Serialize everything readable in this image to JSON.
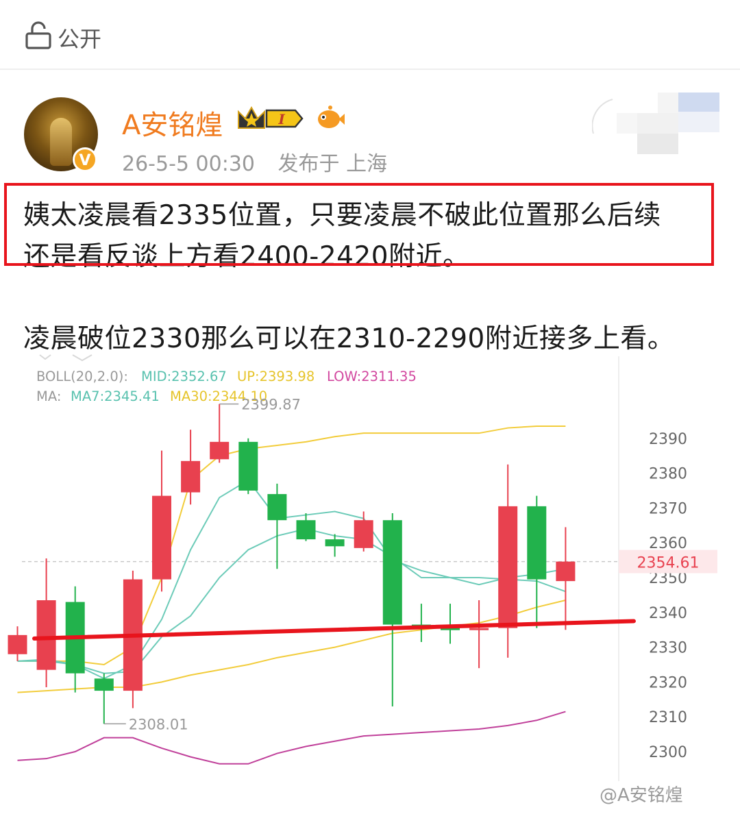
{
  "header": {
    "visibility_label": "公开",
    "lock_icon": "lock-icon"
  },
  "post": {
    "author": "A安铭煌",
    "badges": [
      "crown-badge-icon",
      "fish-badge-icon"
    ],
    "level_badge": "I",
    "verified_icon": "verified-v-icon",
    "timestamp": "26-5-5 00:30",
    "location": "发布于 上海",
    "paragraphs": [
      "姨太凌晨看2335位置，只要凌晨不破此位置那么后续",
      "还是看反谈上方看2400-2420附近。",
      "凌晨破位2330那么可以在2310-2290附近接多上看。"
    ]
  },
  "indicators": {
    "boll_label": "BOLL(20,2.0):",
    "mid": "MID:2352.67",
    "up": "UP:2393.98",
    "low": "LOW:2311.35",
    "ma_label": "MA:",
    "ma7": "MA7:2345.41",
    "ma30": "MA30:2344.10"
  },
  "watermark": "@A安铭煌",
  "colors": {
    "up": "#e8414f",
    "down": "#22b24c",
    "boll_up": "#f2cc3a",
    "boll_low": "#c0409a",
    "mid": "#6ccbb8",
    "highlight": "#e8141c",
    "username": "#f07b1f"
  },
  "chart_data": {
    "type": "candlestick",
    "yticks": [
      2300,
      2310,
      2320,
      2330,
      2340,
      2350,
      2360,
      2370,
      2380,
      2390
    ],
    "ylim": [
      2297.5,
      2399
    ],
    "current_price": 2354.61,
    "annotations": {
      "high": "2399.87",
      "low": "2308.01",
      "current": "2354.61"
    },
    "candles": [
      {
        "o": 2328.0,
        "c": 2333.5,
        "h": 2336.0,
        "l": 2326.0
      },
      {
        "o": 2323.5,
        "c": 2343.5,
        "h": 2355.5,
        "l": 2318.5
      },
      {
        "o": 2343.0,
        "c": 2322.5,
        "h": 2347.5,
        "l": 2317.0
      },
      {
        "o": 2321.0,
        "c": 2317.5,
        "h": 2322.5,
        "l": 2308.0
      },
      {
        "o": 2317.5,
        "c": 2349.5,
        "h": 2352.0,
        "l": 2312.5
      },
      {
        "o": 2349.5,
        "c": 2373.5,
        "h": 2386.5,
        "l": 2346.0
      },
      {
        "o": 2374.5,
        "c": 2383.5,
        "h": 2392.5,
        "l": 2371.0
      },
      {
        "o": 2384.0,
        "c": 2389.0,
        "h": 2399.87,
        "l": 2383.0
      },
      {
        "o": 2389.0,
        "c": 2375.0,
        "h": 2390.0,
        "l": 2374.0
      },
      {
        "o": 2374.0,
        "c": 2366.5,
        "h": 2377.0,
        "l": 2352.5
      },
      {
        "o": 2366.5,
        "c": 2361.0,
        "h": 2368.5,
        "l": 2360.5
      },
      {
        "o": 2361.0,
        "c": 2359.0,
        "h": 2362.5,
        "l": 2356.0
      },
      {
        "o": 2358.5,
        "c": 2366.5,
        "h": 2369.0,
        "l": 2357.5
      },
      {
        "o": 2366.5,
        "c": 2336.5,
        "h": 2368.5,
        "l": 2313.0
      },
      {
        "o": 2336.5,
        "c": 2336.0,
        "h": 2342.5,
        "l": 2331.5
      },
      {
        "o": 2335.5,
        "c": 2335.0,
        "h": 2342.5,
        "l": 2331.0
      },
      {
        "o": 2335.0,
        "c": 2335.5,
        "h": 2343.5,
        "l": 2324.0
      },
      {
        "o": 2335.5,
        "c": 2370.5,
        "h": 2382.5,
        "l": 2327.0
      },
      {
        "o": 2370.5,
        "c": 2349.5,
        "h": 2373.5,
        "l": 2335.5
      },
      {
        "o": 2349.0,
        "c": 2354.61,
        "h": 2364.5,
        "l": 2335.0
      }
    ],
    "boll_up": [
      2326,
      2326,
      2326,
      2325,
      2330,
      2350,
      2378,
      2385,
      2387,
      2388,
      2389,
      2390.5,
      2391.5,
      2391.5,
      2391.5,
      2391.5,
      2391.5,
      2393,
      2393.5,
      2393.5
    ],
    "boll_mid": [
      2326,
      2326,
      2325,
      2321,
      2325,
      2338,
      2358,
      2373,
      2378,
      2367,
      2368,
      2369,
      2367,
      2355,
      2352,
      2350,
      2348,
      2350,
      2351,
      2352.5
    ],
    "ma7": [
      2326,
      2326.5,
      2325,
      2322.5,
      2323,
      2333,
      2339,
      2350,
      2358,
      2362,
      2364,
      2362,
      2361,
      2356,
      2350,
      2350,
      2350,
      2349.5,
      2349,
      2346
    ],
    "ma30": [
      2317,
      2317.5,
      2318,
      2318.5,
      2318.5,
      2320,
      2322,
      2323.5,
      2325,
      2327,
      2328.5,
      2330,
      2332,
      2334,
      2335,
      2336,
      2337,
      2339,
      2341.5,
      2343.5
    ],
    "boll_low": [
      2297.5,
      2298,
      2300,
      2304,
      2304,
      2301,
      2298.5,
      2296.5,
      2296.5,
      2299.5,
      2301.5,
      2303,
      2304.5,
      2305,
      2305.5,
      2306,
      2306.5,
      2307.5,
      2309,
      2311.5
    ],
    "support_line": {
      "from": 2332.5,
      "to": 2337.5
    }
  }
}
